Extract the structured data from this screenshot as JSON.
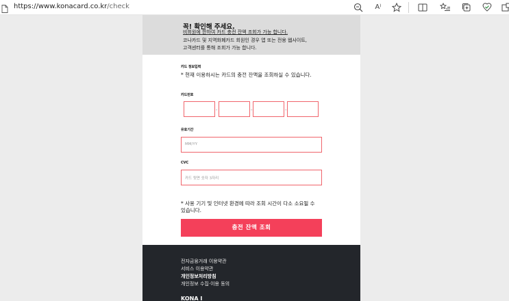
{
  "browser": {
    "url_host": "https://www.konacard.co.kr",
    "url_path": "/check",
    "read_aloud_label": "A⁾"
  },
  "notice": {
    "title": "꼭! 확인해 주세요.",
    "line1": "비회원에 한하여 카드 충전 잔액 조회가 가능 합니다.",
    "line2": "코나카드 및 지역화폐카드 회원인 경우 앱 또는 전용 웹사이트,",
    "line3": "고객센터를 통해 조회가 가능 합니다."
  },
  "card_info": {
    "heading": "카드 정보입력",
    "description": "* 현재 이용하시는 카드의 충전 잔액을 조회하실 수 있습니다."
  },
  "form": {
    "card_number_label": "카드번호",
    "separator": "-",
    "expiry_label": "유효기간",
    "expiry_placeholder": "MM/YY",
    "cvc_label": "CVC",
    "cvc_placeholder": "카드 뒷면 숫자 3자리"
  },
  "warning": {
    "line1": "* 사용 기기 및 인터넷 환경에 따라 조회 시간이 다소 소요될 수",
    "line2": "있습니다."
  },
  "submit_label": "충전 잔액 조회",
  "footer": {
    "links": [
      "전자금융거래 이용약관",
      "서비스 이용약관",
      "개인정보처리방침",
      "개인정보 수집·이용 동의"
    ],
    "logo": "KONA I"
  },
  "colors": {
    "accent": "#f4405a",
    "input_border": "#f0636a",
    "notice_bg": "#dcdcdc",
    "footer_bg": "#23262b"
  }
}
